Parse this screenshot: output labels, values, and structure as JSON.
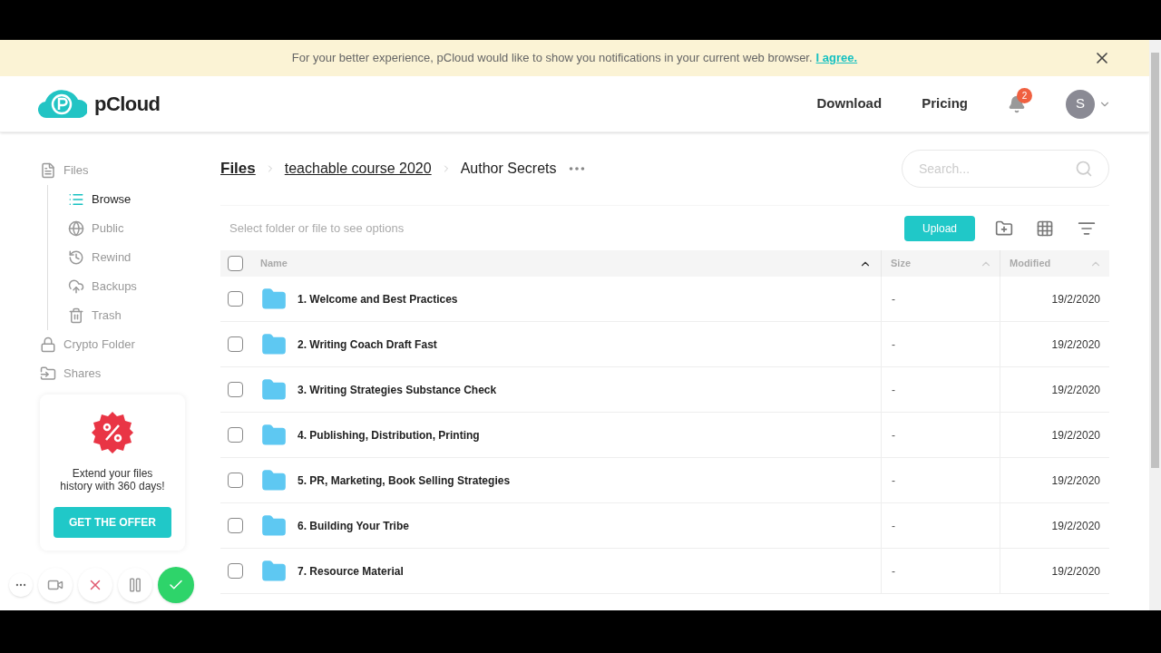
{
  "banner": {
    "message": "For your better experience, pCloud would like to show you notifications in your current web browser.",
    "link": "I agree."
  },
  "header": {
    "logo": "pCloud",
    "nav": [
      "Download",
      "Pricing"
    ],
    "notification_count": "2",
    "avatar": "S"
  },
  "sidebar": {
    "items": [
      {
        "label": "Files",
        "selected": false,
        "children": [
          {
            "label": "Browse",
            "selected": true
          },
          {
            "label": "Public",
            "selected": false
          },
          {
            "label": "Rewind",
            "selected": false
          },
          {
            "label": "Backups",
            "selected": false
          },
          {
            "label": "Trash",
            "selected": false
          }
        ]
      },
      {
        "label": "Crypto Folder",
        "selected": false
      },
      {
        "label": "Shares",
        "selected": false
      }
    ],
    "promo": {
      "text": "Extend your files history with 360 days!",
      "button": "GET THE OFFER"
    }
  },
  "breadcrumb": [
    {
      "label": "Files",
      "kind": "root"
    },
    {
      "label": "teachable course 2020",
      "kind": "link"
    },
    {
      "label": "Author Secrets",
      "kind": "current"
    }
  ],
  "search": {
    "placeholder": "Search..."
  },
  "toolbar": {
    "hint": "Select folder or file to see options",
    "upload": "Upload"
  },
  "table": {
    "select_all_checked": false,
    "columns": [
      {
        "label": "Name",
        "sorted": true
      },
      {
        "label": "Size",
        "sorted": false
      },
      {
        "label": "Modified",
        "sorted": false
      }
    ],
    "rows": [
      {
        "name": "1. Welcome and Best Practices",
        "size": "-",
        "modified": "19/2/2020",
        "checked": false
      },
      {
        "name": "2. Writing Coach Draft Fast",
        "size": "-",
        "modified": "19/2/2020",
        "checked": false
      },
      {
        "name": "3. Writing Strategies Substance Check",
        "size": "-",
        "modified": "19/2/2020",
        "checked": false
      },
      {
        "name": "4. Publishing, Distribution, Printing",
        "size": "-",
        "modified": "19/2/2020",
        "checked": false
      },
      {
        "name": "5. PR, Marketing, Book Selling Strategies",
        "size": "-",
        "modified": "19/2/2020",
        "checked": false
      },
      {
        "name": "6. Building Your Tribe",
        "size": "-",
        "modified": "19/2/2020",
        "checked": false
      },
      {
        "name": "7. Resource Material",
        "size": "-",
        "modified": "19/2/2020",
        "checked": false
      }
    ]
  }
}
